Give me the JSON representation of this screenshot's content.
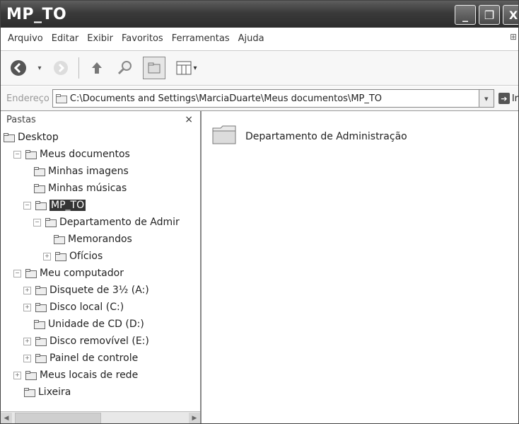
{
  "window": {
    "title": "MP_TO"
  },
  "titlebar": {
    "minimize": "_",
    "maximize": "❐",
    "close": "X"
  },
  "menu": [
    "Arquivo",
    "Editar",
    "Exibir",
    "Favoritos",
    "Ferramentas",
    "Ajuda"
  ],
  "address": {
    "label": "Endereço",
    "value": "C:\\Documents and Settings\\MarciaDuarte\\Meus documentos\\MP_TO",
    "go_label": "Ir"
  },
  "folders_pane": {
    "title": "Pastas",
    "close": "×",
    "tree": [
      {
        "label": "Desktop",
        "level": 0,
        "expander": "",
        "icon": "desktop-icon",
        "selected": false
      },
      {
        "label": "Meus documentos",
        "level": 1,
        "expander": "−",
        "icon": "folder-icon",
        "selected": false
      },
      {
        "label": "Minhas imagens",
        "level": 2,
        "expander": "",
        "icon": "images-folder-icon",
        "selected": false
      },
      {
        "label": "Minhas músicas",
        "level": 2,
        "expander": "",
        "icon": "music-folder-icon",
        "selected": false
      },
      {
        "label": "MP_TO",
        "level": 2,
        "expander": "−",
        "icon": "folder-icon",
        "selected": true
      },
      {
        "label": "Departamento de Admir",
        "level": 3,
        "expander": "−",
        "icon": "folder-icon",
        "selected": false
      },
      {
        "label": "Memorandos",
        "level": 4,
        "expander": "",
        "icon": "folder-icon",
        "selected": false
      },
      {
        "label": "Ofícios",
        "level": 4,
        "expander": "+",
        "icon": "folder-icon",
        "selected": false
      },
      {
        "label": "Meu computador",
        "level": 1,
        "expander": "−",
        "icon": "computer-icon",
        "selected": false
      },
      {
        "label": "Disquete de 3½ (A:)",
        "level": 2,
        "expander": "+",
        "icon": "floppy-icon",
        "selected": false
      },
      {
        "label": "Disco local (C:)",
        "level": 2,
        "expander": "+",
        "icon": "drive-icon",
        "selected": false
      },
      {
        "label": "Unidade de CD (D:)",
        "level": 2,
        "expander": "",
        "icon": "cd-drive-icon",
        "selected": false
      },
      {
        "label": "Disco removível (E:)",
        "level": 2,
        "expander": "+",
        "icon": "drive-icon",
        "selected": false
      },
      {
        "label": "Painel de controle",
        "level": 2,
        "expander": "+",
        "icon": "control-panel-icon",
        "selected": false
      },
      {
        "label": "Meus locais de rede",
        "level": 1,
        "expander": "+",
        "icon": "network-icon",
        "selected": false
      },
      {
        "label": "Lixeira",
        "level": 1,
        "expander": "",
        "icon": "recycle-bin-icon",
        "selected": false
      }
    ]
  },
  "content": {
    "items": [
      {
        "label": "Departamento de Administração",
        "icon": "folder-icon"
      }
    ]
  }
}
